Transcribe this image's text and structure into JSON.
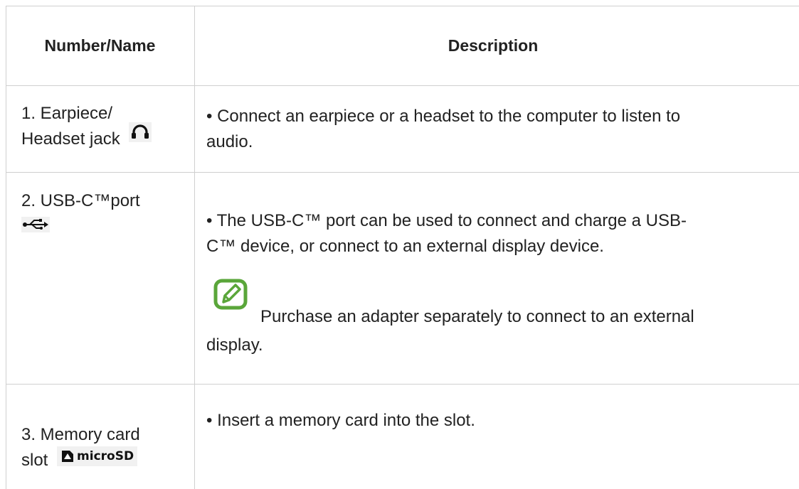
{
  "header": {
    "col1": "Number/Name",
    "col2": "Description"
  },
  "rows": [
    {
      "name_line1": "1. Earpiece/",
      "name_line2": "Headset jack",
      "name_icon": "headset-icon",
      "desc_line1": "• Connect an earpiece or a headset to the computer to listen to",
      "desc_line2": "audio."
    },
    {
      "name_line1": "2. USB-C™port",
      "name_icon": "usb-icon",
      "desc_line1": "• The USB-C™ port can be used to connect and charge a USB-",
      "desc_line2": "C™ device, or connect to an external display device.",
      "note_icon": "note-pen-icon",
      "note_line1": "Purchase an adapter separately to connect to an external",
      "note_line2": "display."
    },
    {
      "name_line1": "3. Memory card",
      "name_line2": "slot",
      "name_icon": "microsd-icon",
      "icon_label": "microSD",
      "desc_line1": "• Insert a memory card into the slot."
    }
  ],
  "colors": {
    "border": "#cfcfcf",
    "note_icon": "#5aa63a",
    "text": "#222222"
  }
}
